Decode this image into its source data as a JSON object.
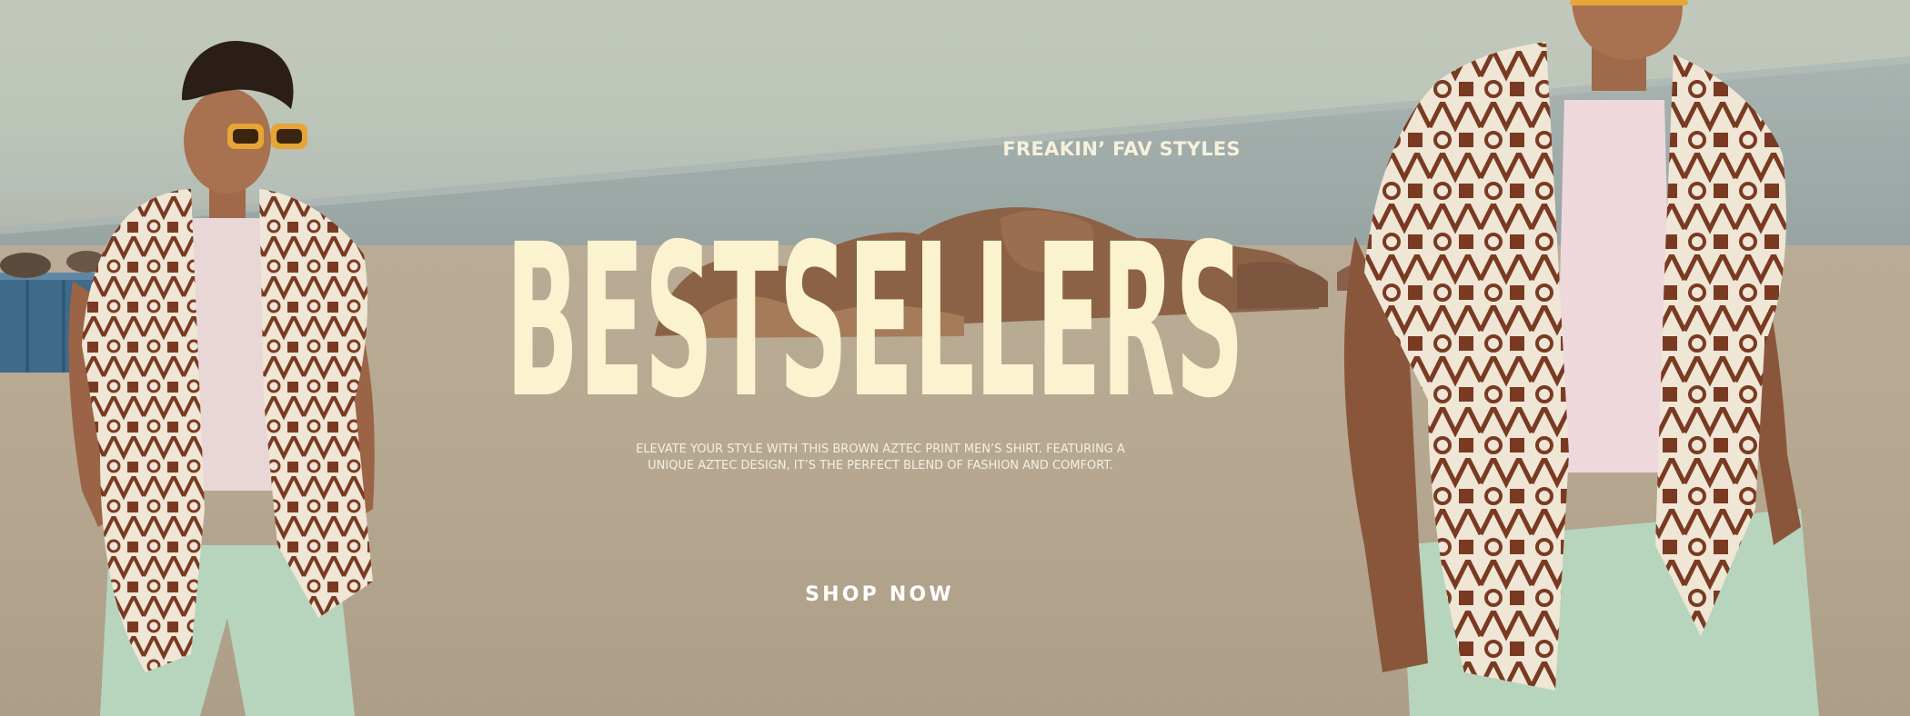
{
  "hero": {
    "eyebrow": "FREAKIN’ FAV STYLES",
    "headline": "BESTSELLERS",
    "description_line1": "ELEVATE YOUR STYLE WITH THIS BROWN AZTEC PRINT MEN’S SHIRT. FEATURING A",
    "description_line2": "UNIQUE AZTEC DESIGN, IT’S THE PERFECT BLEND OF FASHION AND COMFORT.",
    "cta_label": "SHOP NOW"
  },
  "colors": {
    "headline": "#fbf3cf",
    "shirt_print": "#7a3a22",
    "shirt_base": "#efe6d6",
    "shorts": "#b7d4bc",
    "sand": "#b9ab95",
    "sky": "#c2c9bc"
  },
  "icons": [
    "hero-background-image"
  ]
}
